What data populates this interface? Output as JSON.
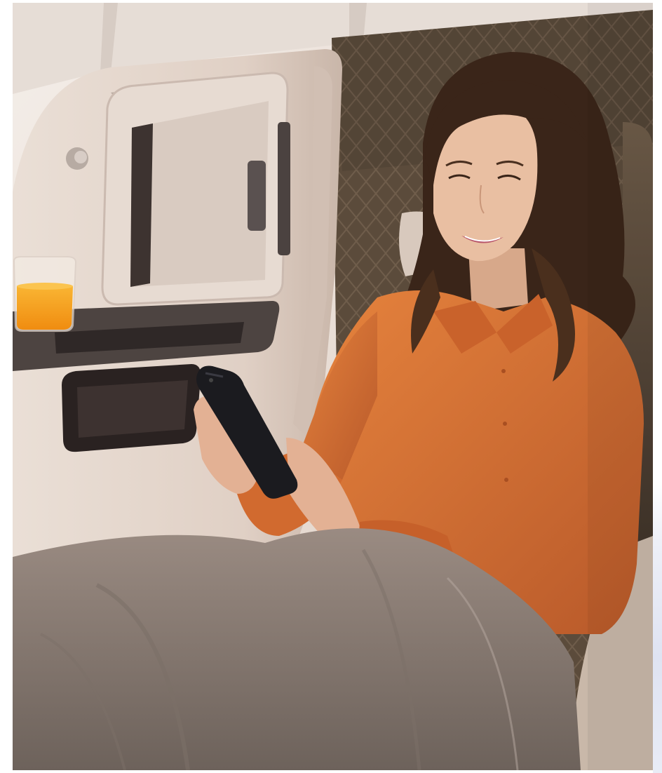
{
  "scene": {
    "subject": "woman-using-smartphone",
    "setting": "aircraft-cabin-seat",
    "palette": {
      "cabin_wall": "#efe7df",
      "shell_panel": "#e4d6cc",
      "seat_back": "#5a4a3a",
      "shirt": "#d9712f",
      "blanket": "#8a7d74",
      "juice": "#f6a21a",
      "phone": "#1b1b1f",
      "hair": "#3a2519",
      "skin": "#e9bfa2"
    }
  }
}
